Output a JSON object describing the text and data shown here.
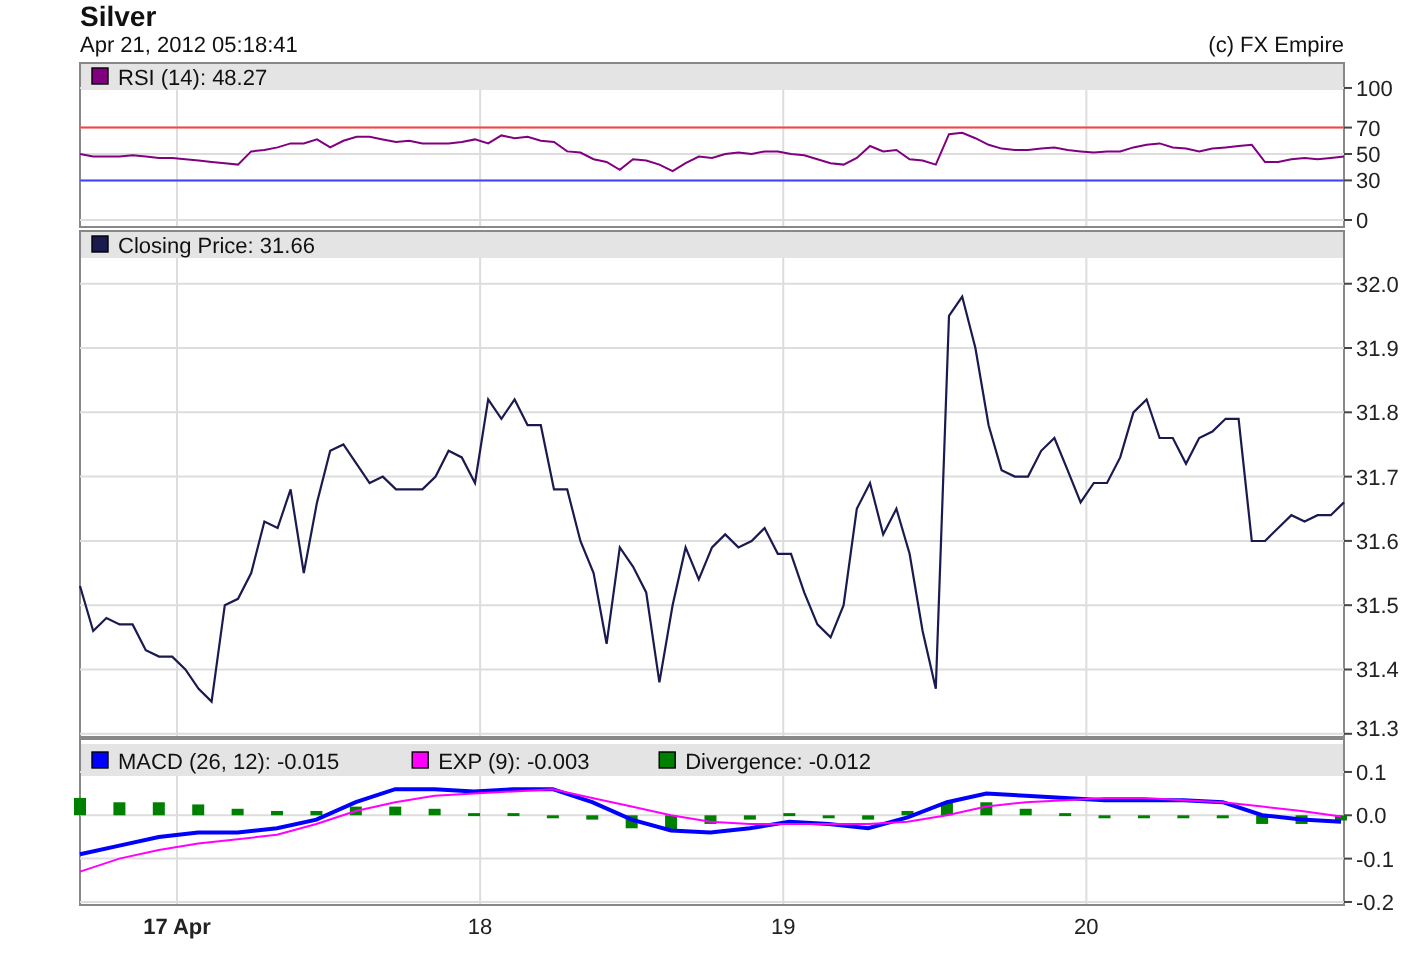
{
  "header": {
    "title": "Silver",
    "timestamp": "Apr 21, 2012 05:18:41",
    "credit": "(c) FX Empire"
  },
  "rsi_panel": {
    "chart_data": {
      "type": "line",
      "ylim": [
        -5.3,
        118.9
      ],
      "yticks": [
        0,
        30,
        50,
        70,
        100
      ],
      "grid": true,
      "series": [
        {
          "name": "RSI (14): 48.27",
          "color": "#800080",
          "values": [
            50,
            48,
            48,
            48,
            49,
            48,
            47,
            47,
            46,
            45,
            44,
            43,
            42,
            52,
            53,
            55,
            58,
            58,
            61,
            55,
            60,
            63,
            63,
            61,
            59,
            60,
            58,
            58,
            58,
            59,
            61,
            58,
            64,
            62,
            63,
            60,
            59,
            52,
            51,
            46,
            44,
            38,
            46,
            45,
            42,
            37,
            43,
            48,
            47,
            50,
            51,
            50,
            52,
            52,
            50,
            49,
            46,
            43,
            42,
            47,
            56,
            52,
            53,
            46,
            45,
            42,
            65,
            66,
            62,
            57,
            54,
            53,
            53,
            54,
            55,
            53,
            52,
            51,
            52,
            52,
            55,
            57,
            58,
            55,
            54,
            52,
            54,
            55,
            56,
            57,
            44,
            44,
            46,
            47,
            46,
            47,
            48
          ]
        }
      ],
      "ref_lines": [
        {
          "axis": "y",
          "value": 70,
          "color": "#ff4040"
        },
        {
          "axis": "y",
          "value": 30,
          "color": "#4040ff"
        }
      ]
    }
  },
  "price_panel": {
    "chart_data": {
      "type": "line",
      "ylim": [
        31.295,
        32.082
      ],
      "grid": true,
      "yticks": [
        {
          "value": 31.3,
          "label": "31.3"
        },
        {
          "value": 31.4,
          "label": "31.4"
        },
        {
          "value": 31.5,
          "label": "31.5"
        },
        {
          "value": 31.6,
          "label": "31.6"
        },
        {
          "value": 31.7,
          "label": "31.7"
        },
        {
          "value": 31.8,
          "label": "31.8"
        },
        {
          "value": 31.9,
          "label": "31.9"
        },
        {
          "value": 32,
          "label": "32.0"
        }
      ],
      "series": [
        {
          "name": "Closing Price: 31.66",
          "color": "#1a1a50",
          "values": [
            31.53,
            31.46,
            31.48,
            31.47,
            31.47,
            31.43,
            31.42,
            31.42,
            31.4,
            31.37,
            31.35,
            31.5,
            31.51,
            31.55,
            31.63,
            31.62,
            31.68,
            31.55,
            31.66,
            31.74,
            31.75,
            31.72,
            31.69,
            31.7,
            31.68,
            31.68,
            31.68,
            31.7,
            31.74,
            31.73,
            31.69,
            31.82,
            31.79,
            31.82,
            31.78,
            31.78,
            31.68,
            31.68,
            31.6,
            31.55,
            31.44,
            31.59,
            31.56,
            31.52,
            31.38,
            31.5,
            31.59,
            31.54,
            31.59,
            31.61,
            31.59,
            31.6,
            31.62,
            31.58,
            31.58,
            31.52,
            31.47,
            31.45,
            31.5,
            31.65,
            31.69,
            31.61,
            31.65,
            31.58,
            31.46,
            31.37,
            31.95,
            31.98,
            31.9,
            31.78,
            31.71,
            31.7,
            31.7,
            31.74,
            31.76,
            31.71,
            31.66,
            31.69,
            31.69,
            31.73,
            31.8,
            31.82,
            31.76,
            31.76,
            31.72,
            31.76,
            31.77,
            31.79,
            31.79,
            31.6,
            31.6,
            31.62,
            31.64,
            31.63,
            31.64,
            31.64,
            31.66
          ]
        }
      ]
    }
  },
  "macd_panel": {
    "chart_data": {
      "type": "line",
      "ylim": [
        -0.207,
        0.176
      ],
      "xlim": [
        16.68,
        20.85
      ],
      "grid": true,
      "legend": "upper left",
      "yticks": [
        {
          "value": 0.1,
          "label": "0.1"
        },
        {
          "value": 0,
          "label": "0.0"
        },
        {
          "value": -0.1,
          "label": "-0.1"
        },
        {
          "value": -0.2,
          "label": "-0.2"
        }
      ],
      "xticks": [
        {
          "value": 17,
          "label": "17 Apr"
        },
        {
          "value": 18,
          "label": "18"
        },
        {
          "value": 19,
          "label": "19"
        },
        {
          "value": 20,
          "label": "20"
        }
      ],
      "x": [
        16.68,
        16.81,
        16.94,
        17.07,
        17.2,
        17.33,
        17.46,
        17.59,
        17.72,
        17.85,
        17.98,
        18.11,
        18.24,
        18.37,
        18.5,
        18.63,
        18.76,
        18.89,
        19.02,
        19.15,
        19.28,
        19.41,
        19.54,
        19.67,
        19.8,
        19.93,
        20.06,
        20.19,
        20.32,
        20.45,
        20.58,
        20.71,
        20.84
      ],
      "series": [
        {
          "name": "MACD (26, 12): -0.015",
          "color": "#0000ff",
          "type": "line",
          "values": [
            -0.09,
            -0.07,
            -0.05,
            -0.04,
            -0.04,
            -0.03,
            -0.01,
            0.03,
            0.06,
            0.06,
            0.055,
            0.06,
            0.06,
            0.03,
            -0.01,
            -0.035,
            -0.04,
            -0.03,
            -0.015,
            -0.02,
            -0.03,
            -0.005,
            0.03,
            0.05,
            0.045,
            0.04,
            0.035,
            0.035,
            0.035,
            0.03,
            0.0,
            -0.01,
            -0.015
          ]
        },
        {
          "name": "EXP (9): -0.003",
          "color": "#ff00ff",
          "type": "line",
          "values": [
            -0.13,
            -0.1,
            -0.08,
            -0.065,
            -0.055,
            -0.045,
            -0.02,
            0.01,
            0.03,
            0.045,
            0.05,
            0.055,
            0.06,
            0.04,
            0.02,
            0.0,
            -0.015,
            -0.02,
            -0.02,
            -0.02,
            -0.02,
            -0.015,
            0.0,
            0.02,
            0.03,
            0.035,
            0.04,
            0.04,
            0.035,
            0.03,
            0.02,
            0.01,
            -0.003
          ]
        },
        {
          "name": "Divergence: -0.012",
          "color": "#008000",
          "type": "bar",
          "values": [
            0.04,
            0.03,
            0.03,
            0.025,
            0.015,
            0.01,
            0.01,
            0.02,
            0.02,
            0.015,
            0.005,
            0.005,
            0.0,
            -0.01,
            -0.03,
            -0.035,
            -0.02,
            -0.01,
            0.005,
            0.0,
            -0.01,
            0.01,
            0.03,
            0.03,
            0.015,
            0.005,
            -0.005,
            -0.005,
            0.0,
            0.0,
            -0.02,
            -0.02,
            -0.012
          ]
        }
      ]
    }
  }
}
